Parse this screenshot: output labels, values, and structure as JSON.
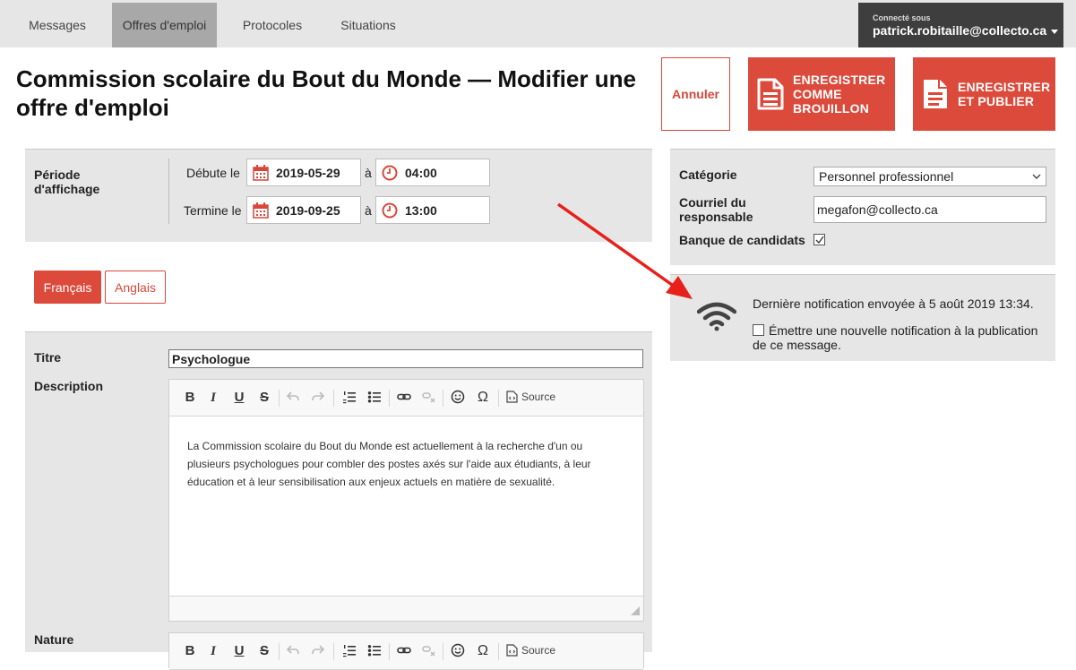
{
  "nav": {
    "items": [
      {
        "label": "Messages",
        "active": false
      },
      {
        "label": "Offres d'emploi",
        "active": true
      },
      {
        "label": "Protocoles",
        "active": false
      },
      {
        "label": "Situations",
        "active": false
      }
    ],
    "user_caption": "Connecté sous",
    "user_email": "patrick.robitaille@collecto.ca"
  },
  "page": {
    "title": "Commission scolaire du Bout du Monde — Modifier une offre d'emploi"
  },
  "actions": {
    "cancel": "Annuler",
    "save_draft": "ENREGISTRER COMME BROUILLON",
    "save_publish": "ENREGISTRER ET PUBLIER"
  },
  "period": {
    "label": "Période d'affichage",
    "start_label": "Débute le",
    "start_date": "2019-05-29",
    "start_time": "04:00",
    "end_label": "Termine le",
    "end_date": "2019-09-25",
    "end_time": "13:00",
    "at": "à"
  },
  "meta": {
    "category_label": "Catégorie",
    "category_value": "Personnel professionnel",
    "email_label": "Courriel du responsable",
    "email_value": "megafon@collecto.ca",
    "bank_label": "Banque de candidats",
    "bank_checked": true
  },
  "notification": {
    "last_sent": "Dernière notification envoyée à 5 août 2019 13:34.",
    "emit_label": "Émettre une nouvelle notification à la publication de ce message.",
    "emit_checked": false
  },
  "languages": {
    "active": "Français",
    "other": "Anglais"
  },
  "form": {
    "title_label": "Titre",
    "title_value": "Psychologue",
    "description_label": "Description",
    "description_text": "La Commission scolaire du Bout du Monde est actuellement à la recherche d'un ou plusieurs psychologues pour combler des postes axés sur l'aide aux étudiants, à leur éducation et à leur sensibilisation aux enjeux actuels en matière de sexualité.",
    "nature_label": "Nature"
  },
  "toolbar": {
    "bold": "B",
    "italic": "I",
    "underline": "U",
    "strike": "S",
    "omega": "Ω",
    "source": "Source"
  },
  "colors": {
    "accent": "#dc4a3b",
    "nav_bg": "#e6e6e6",
    "nav_active": "#a8a8a8",
    "user_bg": "#3e3e3e",
    "annotation_arrow": "#e8201c"
  }
}
